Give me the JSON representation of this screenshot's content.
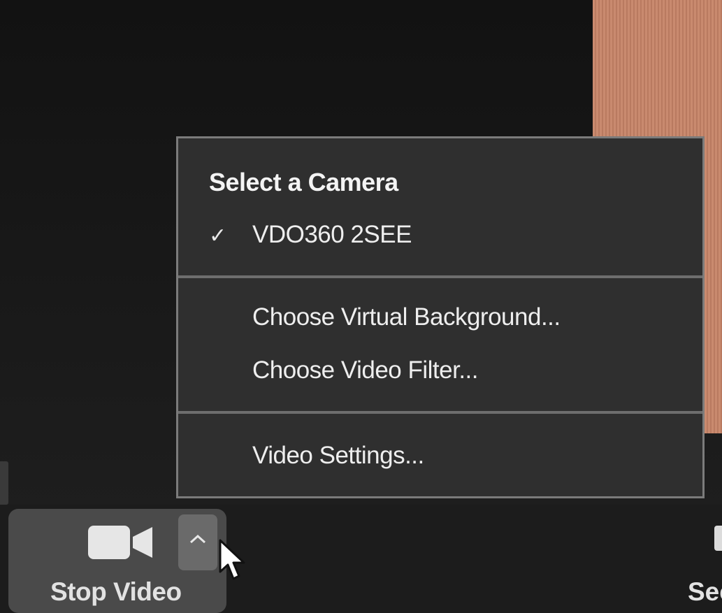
{
  "menu": {
    "header": "Select a Camera",
    "cameras": [
      {
        "label": "VDO360 2SEE",
        "selected": true,
        "check_glyph": "✓"
      }
    ],
    "items": [
      {
        "label": "Choose Virtual Background..."
      },
      {
        "label": "Choose Video Filter..."
      },
      {
        "label": "Video Settings..."
      }
    ]
  },
  "toolbar": {
    "stop_video_label": "Stop Video",
    "stop_video_icon": "video-camera-icon",
    "options_icon": "chevron-up-icon",
    "partial_next_label": "Sec"
  },
  "colors": {
    "menu_bg": "#2f2f2f",
    "menu_border": "#7b7b7b",
    "button_bg": "#4a4a4a",
    "video_tile": "#c98a6f"
  }
}
